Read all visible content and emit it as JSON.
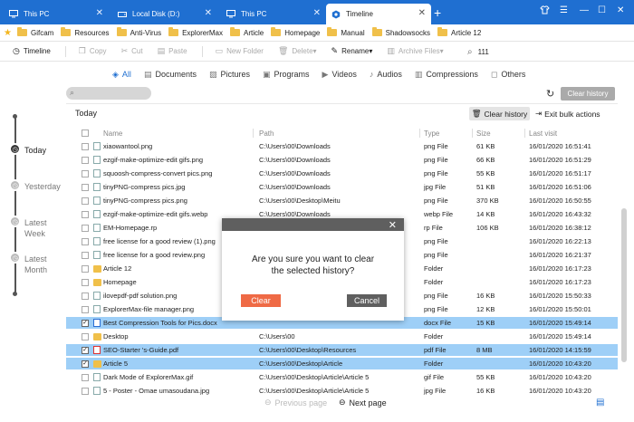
{
  "tabs": [
    {
      "label": "This PC",
      "icon": "monitor-icon",
      "active": false
    },
    {
      "label": "Local Disk (D:)",
      "icon": "drive-icon",
      "active": false
    },
    {
      "label": "This PC",
      "icon": "monitor-icon",
      "active": false
    },
    {
      "label": "Timeline",
      "icon": "timeline-icon",
      "active": true
    }
  ],
  "bookmarks": [
    "Gifcam",
    "Resources",
    "Anti-Virus",
    "ExplorerMax",
    "Article",
    "Homepage",
    "Manual",
    "Shadowsocks",
    "Article 12"
  ],
  "toolbar": {
    "timeline": "Timeline",
    "copy": "Copy",
    "cut": "Cut",
    "paste": "Paste",
    "new_folder": "New Folder",
    "delete": "Delete",
    "rename": "Rename",
    "archive": "Archive Files",
    "search_value": "111"
  },
  "categories": [
    "All",
    "Documents",
    "Pictures",
    "Programs",
    "Videos",
    "Audios",
    "Compressions",
    "Others"
  ],
  "clear_history_top": "Clear history",
  "timeline": [
    "Today",
    "Yesterday",
    "Latest\nWeek",
    "Latest\nMonth"
  ],
  "section": {
    "title": "Today",
    "clear_btn": "Clear history",
    "exit_btn": "Exit bulk actions"
  },
  "columns": {
    "name": "Name",
    "path": "Path",
    "type": "Type",
    "size": "Size",
    "last": "Last visit"
  },
  "rows": [
    {
      "name": "xiaowantool.png",
      "path": "C:\\Users\\00\\Downloads",
      "type": "png File",
      "size": "61 KB",
      "last": "16/01/2020 16:51:41",
      "kind": "file",
      "selected": false
    },
    {
      "name": "ezgif-make-optimize-edit gifs.png",
      "path": "C:\\Users\\00\\Downloads",
      "type": "png File",
      "size": "66 KB",
      "last": "16/01/2020 16:51:29",
      "kind": "file",
      "selected": false
    },
    {
      "name": "squoosh-compress-convert pics.png",
      "path": "C:\\Users\\00\\Downloads",
      "type": "png File",
      "size": "55 KB",
      "last": "16/01/2020 16:51:17",
      "kind": "file",
      "selected": false
    },
    {
      "name": "tinyPNG-compress pics.jpg",
      "path": "C:\\Users\\00\\Downloads",
      "type": "jpg File",
      "size": "51 KB",
      "last": "16/01/2020 16:51:06",
      "kind": "file",
      "selected": false
    },
    {
      "name": "tinyPNG-compress pics.png",
      "path": "C:\\Users\\00\\Desktop\\Meitu",
      "type": "png File",
      "size": "370 KB",
      "last": "16/01/2020 16:50:55",
      "kind": "file",
      "selected": false
    },
    {
      "name": "ezgif-make-optimize-edit gifs.webp",
      "path": "C:\\Users\\00\\Downloads",
      "type": "webp File",
      "size": "14 KB",
      "last": "16/01/2020 16:43:32",
      "kind": "file",
      "selected": false
    },
    {
      "name": "EM-Homepage.rp",
      "path": "",
      "type": "rp File",
      "size": "106 KB",
      "last": "16/01/2020 16:38:12",
      "kind": "file",
      "selected": false
    },
    {
      "name": "free license for a good review (1).png",
      "path": "",
      "type": "png File",
      "size": "",
      "last": "16/01/2020 16:22:13",
      "kind": "file",
      "selected": false
    },
    {
      "name": "free license for a good review.png",
      "path": "",
      "type": "png File",
      "size": "",
      "last": "16/01/2020 16:21:37",
      "kind": "file",
      "selected": false
    },
    {
      "name": "Article 12",
      "path": "",
      "type": "Folder",
      "size": "",
      "last": "16/01/2020 16:17:23",
      "kind": "folder",
      "selected": false
    },
    {
      "name": "Homepage",
      "path": "",
      "type": "Folder",
      "size": "",
      "last": "16/01/2020 16:17:23",
      "kind": "folder",
      "selected": false
    },
    {
      "name": "ilovepdf-pdf solution.png",
      "path": "",
      "type": "png File",
      "size": "16 KB",
      "last": "16/01/2020 15:50:33",
      "kind": "file",
      "selected": false
    },
    {
      "name": "ExplorerMax-file manager.png",
      "path": "",
      "type": "png File",
      "size": "12 KB",
      "last": "16/01/2020 15:50:01",
      "kind": "file",
      "selected": false
    },
    {
      "name": "Best Compression Tools for Pics.docx",
      "path": "",
      "type": "docx File",
      "size": "15 KB",
      "last": "16/01/2020 15:49:14",
      "kind": "docx",
      "selected": true
    },
    {
      "name": "Desktop",
      "path": "C:\\Users\\00",
      "type": "Folder",
      "size": "",
      "last": "16/01/2020 15:49:14",
      "kind": "folder",
      "selected": false
    },
    {
      "name": "SEO-Starter  's-Guide.pdf",
      "path": "C:\\Users\\00\\Desktop\\Resources",
      "type": "pdf File",
      "size": "8 MB",
      "last": "16/01/2020 14:15:59",
      "kind": "pdf",
      "selected": true
    },
    {
      "name": "Article 5",
      "path": "C:\\Users\\00\\Desktop\\Article",
      "type": "Folder",
      "size": "",
      "last": "16/01/2020 10:43:20",
      "kind": "folder",
      "selected": true
    },
    {
      "name": "Dark Mode of ExplorerMax.gif",
      "path": "C:\\Users\\00\\Desktop\\Article\\Article 5",
      "type": "gif File",
      "size": "55 KB",
      "last": "16/01/2020 10:43:20",
      "kind": "file",
      "selected": false
    },
    {
      "name": "5 - Poster - Omae umasoudana.jpg",
      "path": "C:\\Users\\00\\Desktop\\Article\\Article 5",
      "type": "jpg File",
      "size": "16 KB",
      "last": "16/01/2020 10:43:20",
      "kind": "file",
      "selected": false
    }
  ],
  "pager": {
    "prev": "Previous page",
    "next": "Next page"
  },
  "modal": {
    "message": "Are you sure you want to clear\nthe selected history?",
    "confirm": "Clear",
    "cancel": "Cancel"
  },
  "colors": {
    "brand": "#1f6fd1",
    "selected_row": "#9ecff7",
    "danger": "#ef6a45",
    "dark": "#5f5f5f"
  }
}
